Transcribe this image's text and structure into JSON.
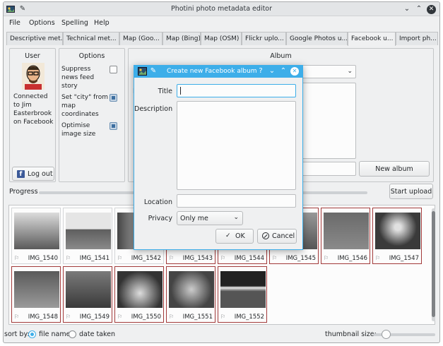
{
  "window": {
    "title": "Photini photo metadata editor"
  },
  "menu": [
    "File",
    "Options",
    "Spelling",
    "Help"
  ],
  "tabs": [
    "Descriptive met...",
    "Technical met...",
    "Map (Goo...",
    "Map (Bing)",
    "Map (OSM)",
    "Flickr uplo...",
    "Google Photos u...",
    "Facebook u...",
    "Import ph..."
  ],
  "user": {
    "title": "User",
    "status": [
      "Connected",
      "to Jim",
      "Easterbrook",
      "on Facebook"
    ],
    "logout": "Log out"
  },
  "options": {
    "title": "Options",
    "items": [
      {
        "lines": [
          "Suppress",
          "news feed",
          "story"
        ],
        "checked": false
      },
      {
        "lines": [
          "Set \"city\" from",
          "map",
          "coordinates"
        ],
        "checked": true
      },
      {
        "lines": [
          "Optimise",
          "image size"
        ],
        "checked": true
      }
    ]
  },
  "album": {
    "title": "Album",
    "desc_label_fragment": "D",
    "new_album": "New album"
  },
  "progress": {
    "label": "Progress",
    "upload": "Start upload",
    "value": 0
  },
  "thumbnails": [
    {
      "name": "IMG_1540",
      "selected": false
    },
    {
      "name": "IMG_1541",
      "selected": false
    },
    {
      "name": "IMG_1542",
      "selected": false
    },
    {
      "name": "IMG_1543",
      "selected": true
    },
    {
      "name": "IMG_1544",
      "selected": true
    },
    {
      "name": "IMG_1545",
      "selected": true
    },
    {
      "name": "IMG_1546",
      "selected": true
    },
    {
      "name": "IMG_1547",
      "selected": true
    },
    {
      "name": "IMG_1548",
      "selected": true
    },
    {
      "name": "IMG_1549",
      "selected": true
    },
    {
      "name": "IMG_1550",
      "selected": true
    },
    {
      "name": "IMG_1551",
      "selected": true
    },
    {
      "name": "IMG_1552",
      "selected": true
    }
  ],
  "status": {
    "sort_by": "sort by:",
    "file_name": "file name",
    "date_taken": "date taken",
    "thumb_size": "thumbnail size:"
  },
  "dialog": {
    "title": "Create new Facebook album",
    "title_label": "Title",
    "title_value": "",
    "description_label": "Description",
    "location_label": "Location",
    "privacy_label": "Privacy",
    "privacy_value": "Only me",
    "ok": "OK",
    "cancel": "Cancel"
  },
  "colors": {
    "accent": "#3daee9",
    "selection": "#a23a3a"
  }
}
